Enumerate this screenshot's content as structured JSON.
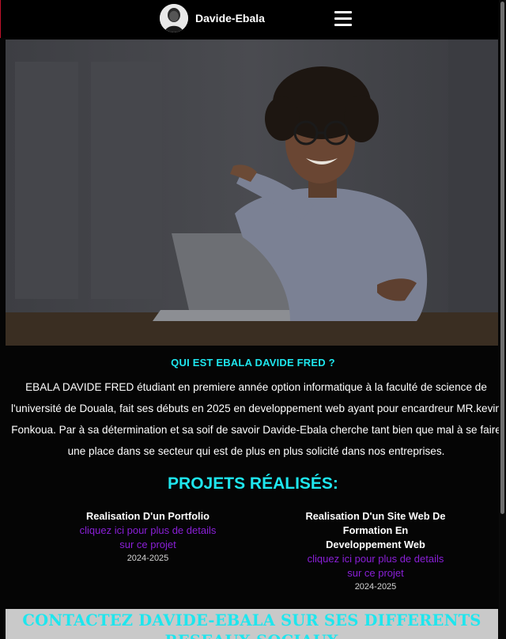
{
  "header": {
    "brand": "Davide-Ebala",
    "menu_icon": "hamburger-icon",
    "avatar": "profile-avatar"
  },
  "hero": {
    "image": "smiling man pointing at laptop"
  },
  "about": {
    "title": "QUI EST EBALA DAVIDE FRED ?",
    "text": "EBALA DAVIDE FRED étudiant en premiere année option informatique à la faculté de science de l'université de Douala, fait ses débuts en 2025 en developpement web ayant pour encardreur MR.kevin Fonkoua. Par à sa détermination et sa soif de savoir Davide-Ebala cherche tant bien que mal à se faire une place dans se secteur qui est de plus en plus solicité dans nos entreprises."
  },
  "projects": {
    "title": "PROJETS RÉALISÉS:",
    "items": [
      {
        "title": "Realisation D'un Portfolio",
        "link": "cliquez ici pour plus de details sur ce projet",
        "date": "2024-2025"
      },
      {
        "title": "Realisation D'un Site Web De Formation En Developpement Web",
        "link": "cliquez ici pour plus de details sur ce projet",
        "date": "2024-2025"
      }
    ]
  },
  "contact": {
    "title": "CONTACTEZ DAVIDE-EBALA SUR SES DIFFERENTS RESEAUX SOCIAUX"
  },
  "colors": {
    "accent": "#1ee6ee",
    "link": "#8a1fd8",
    "background": "#050505"
  }
}
